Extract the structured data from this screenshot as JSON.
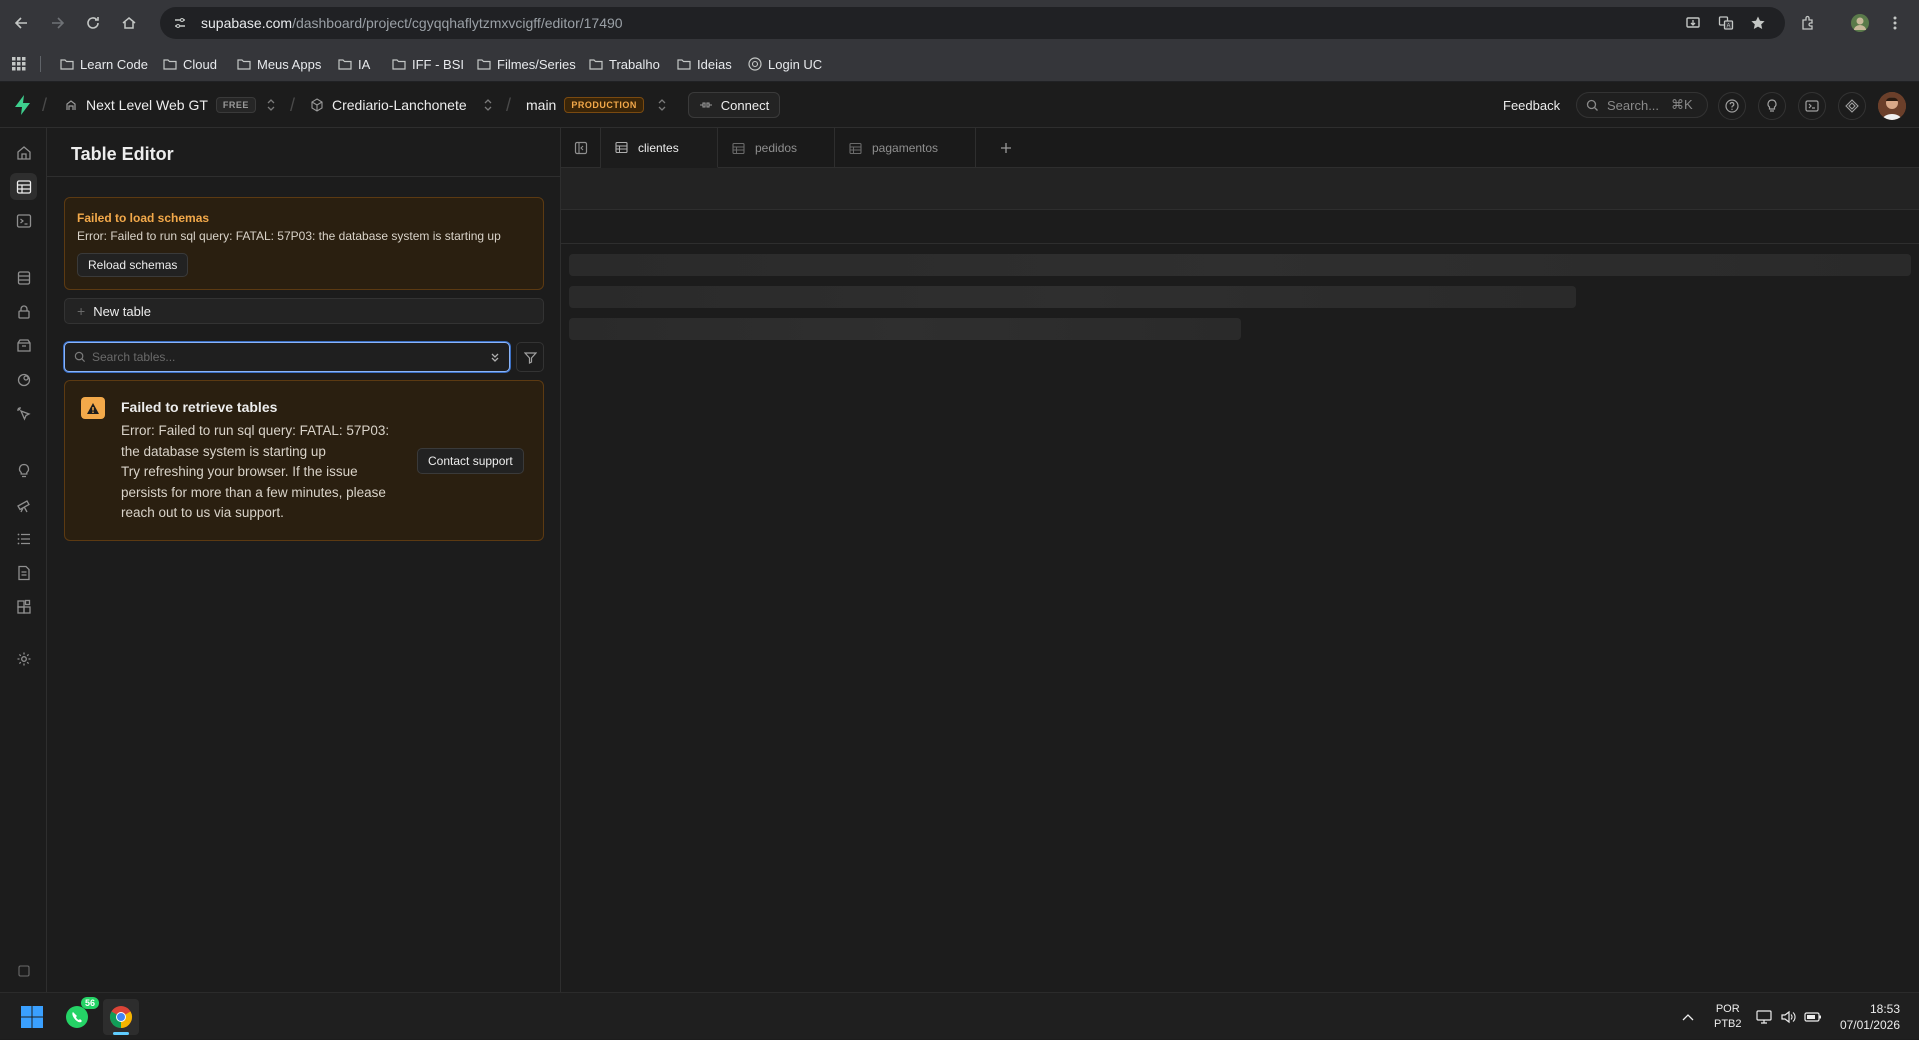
{
  "browser": {
    "url_host": "supabase.com",
    "url_path": "/dashboard/project/cgyqqhaflytzmxvcigff/editor/17490",
    "bookmarks": [
      {
        "label": "Learn Code",
        "icon": "folder-icon"
      },
      {
        "label": "Cloud",
        "icon": "folder-icon"
      },
      {
        "label": "Meus Apps",
        "icon": "folder-icon"
      },
      {
        "label": "IA",
        "icon": "folder-icon"
      },
      {
        "label": "IFF - BSI",
        "icon": "folder-icon"
      },
      {
        "label": "Filmes/Series",
        "icon": "folder-icon"
      },
      {
        "label": "Trabalho",
        "icon": "folder-icon"
      },
      {
        "label": "Ideias",
        "icon": "folder-icon"
      },
      {
        "label": "Login UC",
        "icon": "globe-icon"
      }
    ]
  },
  "header": {
    "org_name": "Next Level Web GT",
    "org_badge": "FREE",
    "project_name": "Crediario-Lanchonete",
    "branch_name": "main",
    "branch_badge": "PRODUCTION",
    "connect_label": "Connect",
    "feedback_label": "Feedback",
    "search_placeholder": "Search...",
    "search_shortcut": "⌘K"
  },
  "sidebar": {
    "title": "Table Editor",
    "schema_error": {
      "title": "Failed to load schemas",
      "detail": "Error: Failed to run sql query: FATAL: 57P03: the database system is starting up",
      "reload_label": "Reload schemas"
    },
    "new_table_label": "New table",
    "search_placeholder": "Search tables...",
    "tables_error": {
      "title": "Failed to retrieve tables",
      "detail": "Error: Failed to run sql query: FATAL: 57P03: the database system is starting up",
      "hint": "Try refreshing your browser. If the issue persists for more than a few minutes, please reach out to us via support.",
      "contact_label": "Contact support"
    }
  },
  "tabs": [
    {
      "label": "clientes",
      "active": true
    },
    {
      "label": "pedidos",
      "active": false
    },
    {
      "label": "pagamentos",
      "active": false
    }
  ],
  "taskbar": {
    "whatsapp_badge": "56",
    "lang_primary": "POR",
    "lang_secondary": "PTB2",
    "time": "18:53",
    "date": "07/01/2026"
  },
  "colors": {
    "accent_green": "#3ecf8e",
    "warning_orange": "#f3a94a",
    "background": "#1c1c1c"
  }
}
